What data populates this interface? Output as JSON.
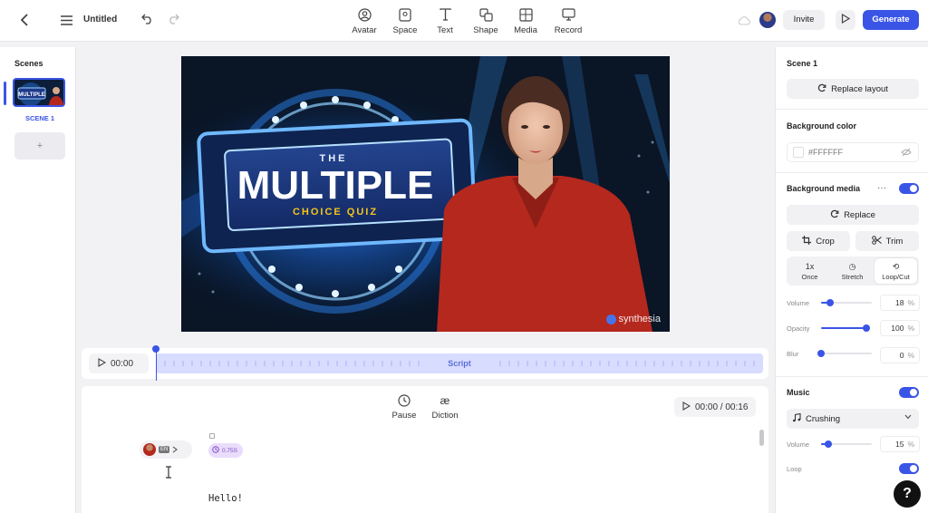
{
  "header": {
    "title": "Untitled",
    "tools": [
      {
        "label": "Avatar",
        "icon": "avatar-icon"
      },
      {
        "label": "Space",
        "icon": "space-icon"
      },
      {
        "label": "Text",
        "icon": "text-icon"
      },
      {
        "label": "Shape",
        "icon": "shape-icon"
      },
      {
        "label": "Media",
        "icon": "media-icon"
      },
      {
        "label": "Record",
        "icon": "record-icon"
      }
    ],
    "invite_label": "Invite",
    "generate_label": "Generate"
  },
  "scenes": {
    "title": "Scenes",
    "items": [
      {
        "label": "SCENE 1",
        "thumb_text": "MULTIPLE"
      }
    ],
    "add_label": "+"
  },
  "canvas": {
    "title_small": "THE",
    "title_big": "MULTIPLE",
    "subtitle": "CHOICE QUIZ",
    "watermark": "synthesia"
  },
  "timeline": {
    "time": "00:00",
    "track_label": "Script"
  },
  "script": {
    "pause_label": "Pause",
    "diction_label": "Diction",
    "diction_icon_text": "æ",
    "time": "00:00 / 00:16",
    "lang": "EN",
    "pause_chip": "0.75S",
    "text": "Hello!"
  },
  "right_panel": {
    "scene_title": "Scene 1",
    "replace_layout": "Replace layout",
    "bg_color_label": "Background color",
    "bg_color_value": "#FFFFFF",
    "bg_media_label": "Background media",
    "bg_media_more": "···",
    "bg_media_on": true,
    "replace": "Replace",
    "crop": "Crop",
    "trim": "Trim",
    "loop_options": [
      {
        "icon": "1x",
        "label": "Once"
      },
      {
        "icon": "◷",
        "label": "Stretch"
      },
      {
        "icon": "⟲",
        "label": "Loop/Cut"
      }
    ],
    "active_loop": "Loop/Cut",
    "volume_label": "Volume",
    "volume_value": "18",
    "opacity_label": "Opacity",
    "opacity_value": "100",
    "blur_label": "Blur",
    "blur_value": "0",
    "percent": "%",
    "music_label": "Music",
    "music_on": true,
    "music_track": "Crushing",
    "music_volume_label": "Volume",
    "music_volume_value": "15",
    "loop_label": "Loop",
    "loop_on": true
  },
  "help_label": "?",
  "colors": {
    "accent": "#3a55e6",
    "canvas_bg": "#0a1526",
    "sign_blue": "#1d3a8a",
    "subtitle_yellow": "#f5c518",
    "shirt_red": "#b5281e"
  }
}
